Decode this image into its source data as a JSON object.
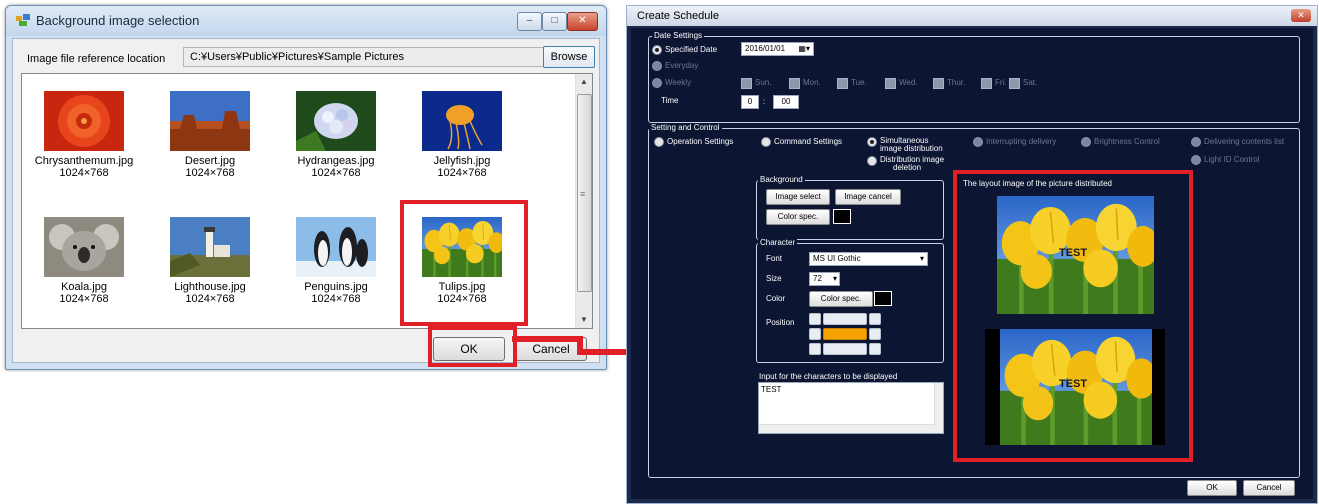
{
  "left_dialog": {
    "title": "Background image selection",
    "ref_label": "Image file reference location",
    "ref_path": "C:¥Users¥Public¥Pictures¥Sample Pictures",
    "browse_label": "Browse",
    "thumbnails": [
      {
        "name": "Chrysanthemum.jpg",
        "dims": "1024×768"
      },
      {
        "name": "Desert.jpg",
        "dims": "1024×768"
      },
      {
        "name": "Hydrangeas.jpg",
        "dims": "1024×768"
      },
      {
        "name": "Jellyfish.jpg",
        "dims": "1024×768"
      },
      {
        "name": "Koala.jpg",
        "dims": "1024×768"
      },
      {
        "name": "Lighthouse.jpg",
        "dims": "1024×768"
      },
      {
        "name": "Penguins.jpg",
        "dims": "1024×768"
      },
      {
        "name": "Tulips.jpg",
        "dims": "1024×768"
      }
    ],
    "ok_label": "OK",
    "cancel_label": "Cancel",
    "window_buttons": {
      "minimize": "–",
      "maximize": "□",
      "close": "✕"
    }
  },
  "right_window": {
    "title": "Create Schedule",
    "close_glyph": "✕",
    "date_settings": {
      "group_label": "Date Settings",
      "specified_date_label": "Specified Date",
      "date_value": "2016/01/01",
      "everyday_label": "Everyday",
      "weekly_label": "Weekly",
      "days": [
        "Sun.",
        "Mon.",
        "Tue.",
        "Wed.",
        "Thur.",
        "Fri.",
        "Sat."
      ],
      "time_label": "Time",
      "time_hour": "0",
      "time_sep": ":",
      "time_min": "00"
    },
    "setting_control": {
      "group_label": "Setting and Control",
      "options": {
        "operation": "Operation Settings",
        "command": "Command Settings",
        "simultaneous_1": "Simultaneous",
        "simultaneous_2": "image distribution",
        "deletion_1": "Distribution image",
        "deletion_2": "deletion",
        "interrupting": "Interrupting delivery",
        "brightness": "Brightness Control",
        "contents_list": "Delivering contents list",
        "light_id": "Light ID Control"
      },
      "background": {
        "group_label": "Background",
        "image_select": "Image select",
        "image_cancel": "Image cancel",
        "color_spec": "Color spec."
      },
      "character": {
        "group_label": "Character",
        "font_label": "Font",
        "font_value": "MS UI Gothic",
        "size_label": "Size",
        "size_value": "72",
        "color_label": "Color",
        "color_spec": "Color spec.",
        "position_label": "Position"
      },
      "input_label": "Input for the characters to be displayed",
      "input_text": "TEST",
      "layout_label": "The layout image of the picture distributed",
      "preview_text": "TEST"
    },
    "ok_label": "OK",
    "cancel_label": "Cancel"
  },
  "colors": {
    "callout": "#e11f26",
    "schedule_bg": "#0c1532",
    "position_selected": "#f5a300"
  }
}
